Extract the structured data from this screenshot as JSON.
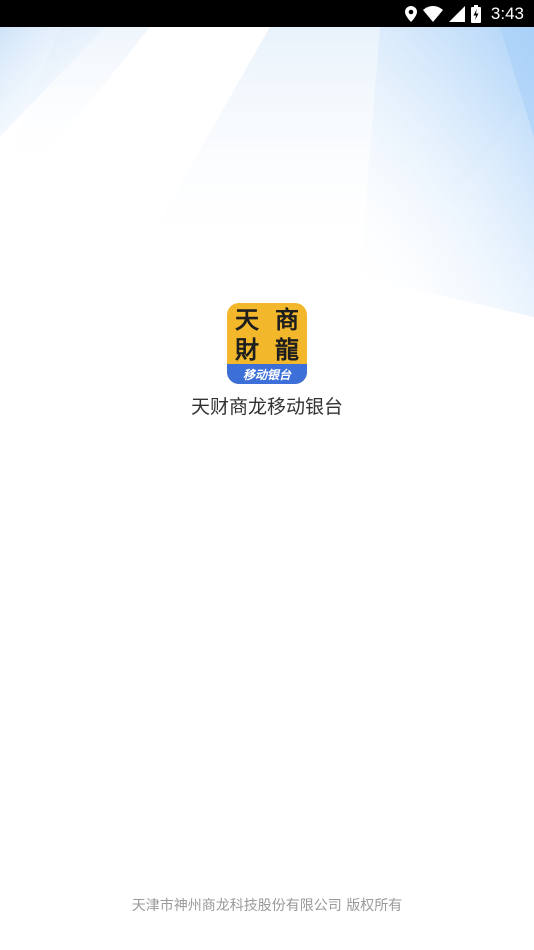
{
  "status_bar": {
    "time": "3:43",
    "icons": [
      "location-icon",
      "wifi-icon",
      "signal-icon",
      "battery-charging-icon"
    ]
  },
  "splash": {
    "logo": {
      "glyphs": [
        "天",
        "商",
        "財",
        "龍"
      ],
      "band_text": "移动银台",
      "colors": {
        "background": "#f2b72b",
        "band": "#3d6fd8",
        "glyph": "#1e1e1e"
      }
    },
    "app_name": "天财商龙移动银台"
  },
  "footer": {
    "copyright": "天津市神州商龙科技股份有限公司 版权所有"
  },
  "theme": {
    "background": "#ffffff",
    "accent_gradient": "#a8d0f8"
  }
}
